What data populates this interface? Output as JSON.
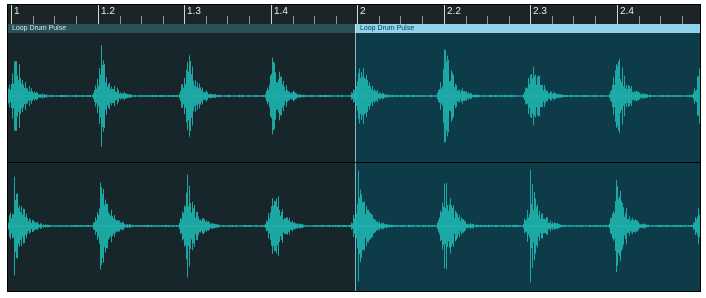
{
  "ruler": {
    "marks": [
      {
        "label": "1",
        "beat": 0
      },
      {
        "label": "1.2",
        "beat": 1
      },
      {
        "label": "1.3",
        "beat": 2
      },
      {
        "label": "1.4",
        "beat": 3
      },
      {
        "label": "2",
        "beat": 4
      },
      {
        "label": "2.2",
        "beat": 5
      },
      {
        "label": "2.3",
        "beat": 6
      },
      {
        "label": "2.4",
        "beat": 7
      }
    ]
  },
  "clips": [
    {
      "name": "Loop Drum Pulse",
      "selected": false
    },
    {
      "name": "Loop Drum Pulse",
      "selected": true
    }
  ],
  "colors": {
    "waveform": "#1fb6b0",
    "waveform_selected": "#23c1b9",
    "clip_bg": "#16262b",
    "clip_bg_selected": "#0d3b47",
    "clip_header": "#2a5058",
    "clip_header_selected": "#8fd2ea"
  }
}
